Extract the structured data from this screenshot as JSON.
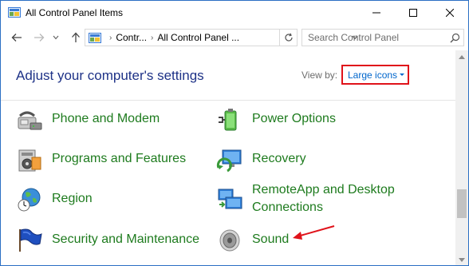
{
  "window": {
    "title": "All Control Panel Items"
  },
  "titlebar": {
    "icons": [
      "control-panel-icon",
      "minimize-icon",
      "maximize-icon",
      "close-icon"
    ]
  },
  "nav": {
    "breadcrumb": [
      "Contr...",
      "All Control Panel ..."
    ],
    "search_placeholder": "Search Control Panel"
  },
  "content": {
    "heading": "Adjust your computer's settings",
    "view_by_label": "View by:",
    "view_by_value": "Large icons",
    "items": [
      {
        "label": "Phone and Modem",
        "icon": "phone-modem-icon"
      },
      {
        "label": "Power Options",
        "icon": "power-options-icon"
      },
      {
        "label": "Programs and Features",
        "icon": "programs-features-icon"
      },
      {
        "label": "Recovery",
        "icon": "recovery-icon"
      },
      {
        "label": "Region",
        "icon": "region-icon"
      },
      {
        "label": "RemoteApp and Desktop Connections",
        "label_line1": "RemoteApp and Desktop",
        "label_line2": "Connections",
        "icon": "remoteapp-icon"
      },
      {
        "label": "Security and Maintenance",
        "icon": "security-maintenance-icon"
      },
      {
        "label": "Sound",
        "icon": "sound-icon"
      }
    ]
  },
  "colors": {
    "heading": "#1e3287",
    "item_label": "#1e7b1e",
    "link": "#0066cc",
    "highlight": "#e0121a"
  }
}
